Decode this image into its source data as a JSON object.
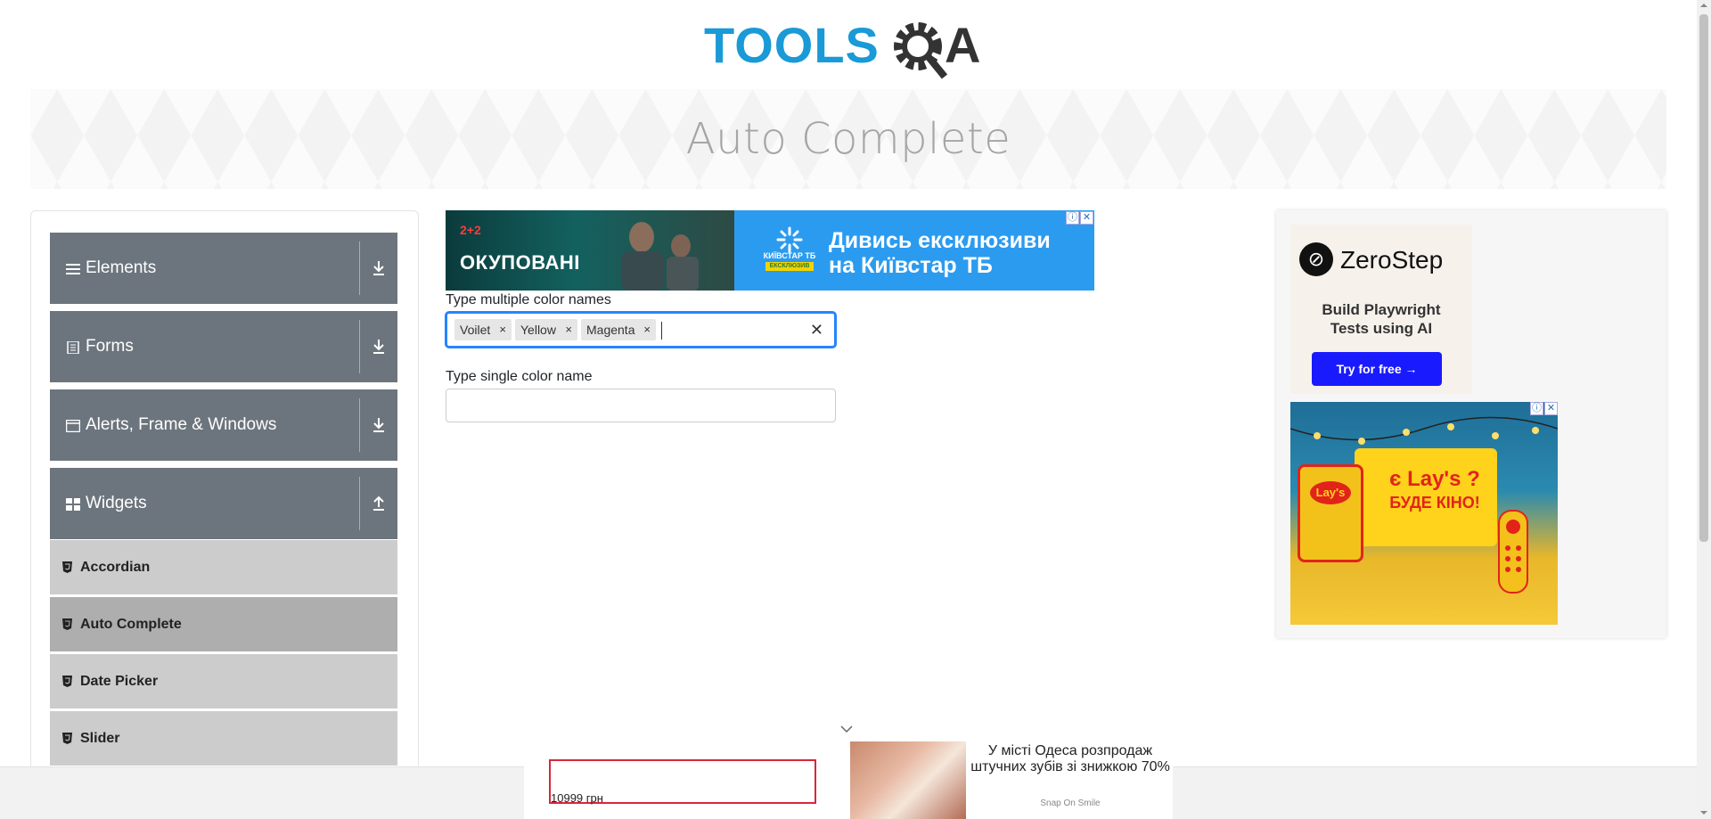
{
  "logo": {
    "text_tools": "TOOLS",
    "text_qa": "QA"
  },
  "banner": {
    "title": "Auto Complete"
  },
  "sidebar": {
    "groups": [
      {
        "label": "Elements",
        "icon": "hamburger-icon"
      },
      {
        "label": "Forms",
        "icon": "document-icon"
      },
      {
        "label": "Alerts, Frame & Windows",
        "icon": "window-icon"
      },
      {
        "label": "Widgets",
        "icon": "widgets-icon"
      }
    ],
    "items": [
      {
        "label": "Accordian"
      },
      {
        "label": "Auto Complete"
      },
      {
        "label": "Date Picker"
      },
      {
        "label": "Slider"
      }
    ]
  },
  "ad_top": {
    "channel": "2+2",
    "series": "ОКУПОВАНІ",
    "brand": "КИЇВСТАР ТБ",
    "brand_badge": "ЕКСКЛЮЗИВ",
    "slogan_line1": "Дивись ексклюзиви",
    "slogan_line2": "на Київстар ТБ"
  },
  "form": {
    "multi_label": "Type multiple color names",
    "multi_values": [
      "Voilet",
      "Yellow",
      "Magenta"
    ],
    "single_label": "Type single color name",
    "single_value": ""
  },
  "right_ad": {
    "zerostep_name": "ZeroStep",
    "zerostep_line1": "Build Playwright",
    "zerostep_line2": "Tests using AI",
    "zerostep_button": "Try for free →",
    "lays_line1": "є Lay's ?",
    "lays_line2": "БУДЕ КІНО!",
    "lays_bag": "Lay's"
  },
  "bottom_ad": {
    "price": "10999 грн",
    "text": "У місті Одеса розпродаж штучних зубів зі знижкою 70%",
    "source": "Snap On Smile"
  },
  "colors": {
    "brand_blue": "#1a9ad6",
    "sidebar_group": "#6c757d",
    "sidebar_item": "#cccccc",
    "sidebar_item_active": "#aeaeae",
    "focus_border": "#2684ff"
  }
}
